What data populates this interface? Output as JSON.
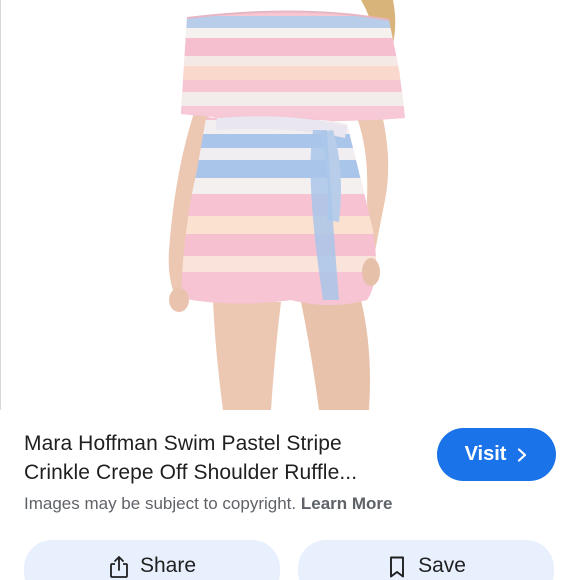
{
  "result": {
    "title_line1": "Mara Hoffman Swim Pastel Stripe",
    "title_line2": "Crinkle Crepe Off Shoulder Ruffle..."
  },
  "visit_button": {
    "label": "Visit",
    "icon": "chevron-right-icon"
  },
  "copyright": {
    "notice": "Images may be subject to copyright.",
    "link_label": "Learn More"
  },
  "actions": [
    {
      "label": "Share",
      "icon": "share-icon"
    },
    {
      "label": "Save",
      "icon": "bookmark-icon"
    }
  ],
  "colors": {
    "accent": "#1a73e8",
    "action_bg": "#e8f0fe",
    "stripe_pink": "#f7c6d3",
    "stripe_blue": "#a9c6ea",
    "stripe_cream": "#fbe3cf",
    "skin": "#eccab5"
  }
}
